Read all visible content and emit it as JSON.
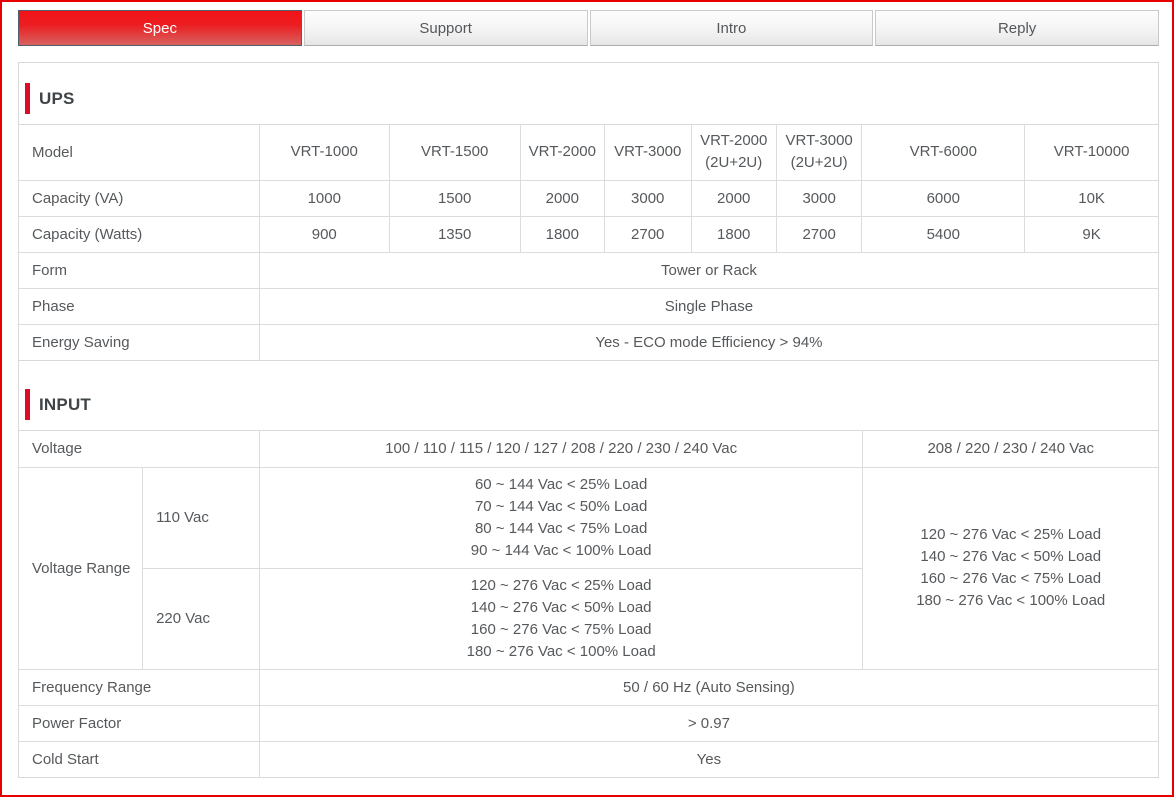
{
  "tabs": [
    {
      "label": "Spec",
      "active": true
    },
    {
      "label": "Support",
      "active": false
    },
    {
      "label": "Intro",
      "active": false
    },
    {
      "label": "Reply",
      "active": false
    }
  ],
  "colors": {
    "page_border": "#e60000",
    "active_tab_red": "#f21318",
    "section_bar_red": "#dc0b27",
    "table_border": "#dcdcdc",
    "text": "#56595c"
  },
  "ups": {
    "title": "UPS",
    "row_labels": {
      "model": "Model",
      "capacity_va": "Capacity (VA)",
      "capacity_watts": "Capacity (Watts)",
      "form": "Form",
      "phase": "Phase",
      "energy_saving": "Energy Saving"
    },
    "models": [
      "VRT-1000",
      "VRT-1500",
      "VRT-2000",
      "VRT-3000",
      "VRT-2000\n(2U+2U)",
      "VRT-3000\n(2U+2U)",
      "VRT-6000",
      "VRT-10000"
    ],
    "capacity_va": [
      "1000",
      "1500",
      "2000",
      "3000",
      "2000",
      "3000",
      "6000",
      "10K"
    ],
    "capacity_watts": [
      "900",
      "1350",
      "1800",
      "2700",
      "1800",
      "2700",
      "5400",
      "9K"
    ],
    "form": "Tower or Rack",
    "phase": "Single Phase",
    "energy_saving": "Yes - ECO mode Efficiency > 94%"
  },
  "input": {
    "title": "INPUT",
    "voltage": {
      "label": "Voltage",
      "value_main": "100 / 110 / 115 / 120 / 127 / 208 / 220 / 230 / 240 Vac",
      "value_high": "208 / 220 / 230 / 240 Vac"
    },
    "voltage_range": {
      "label": "Voltage Range",
      "rows": [
        {
          "label": "110 Vac",
          "value": [
            "60 ~ 144 Vac < 25% Load",
            "70 ~ 144 Vac < 50% Load",
            "80 ~ 144 Vac < 75% Load",
            "90 ~ 144 Vac < 100% Load"
          ]
        },
        {
          "label": "220 Vac",
          "value": [
            "120 ~ 276 Vac < 25% Load",
            "140 ~ 276 Vac < 50% Load",
            "160 ~ 276 Vac < 75% Load",
            "180 ~ 276 Vac < 100% Load"
          ]
        }
      ],
      "value_high": [
        "120 ~ 276 Vac < 25% Load",
        "140 ~ 276 Vac < 50% Load",
        "160 ~ 276 Vac < 75% Load",
        "180 ~ 276 Vac < 100% Load"
      ]
    },
    "frequency": {
      "label": "Frequency Range",
      "value": "50 / 60 Hz (Auto Sensing)"
    },
    "power_factor": {
      "label": "Power Factor",
      "value": "> 0.97"
    },
    "cold_start": {
      "label": "Cold Start",
      "value": "Yes"
    }
  }
}
